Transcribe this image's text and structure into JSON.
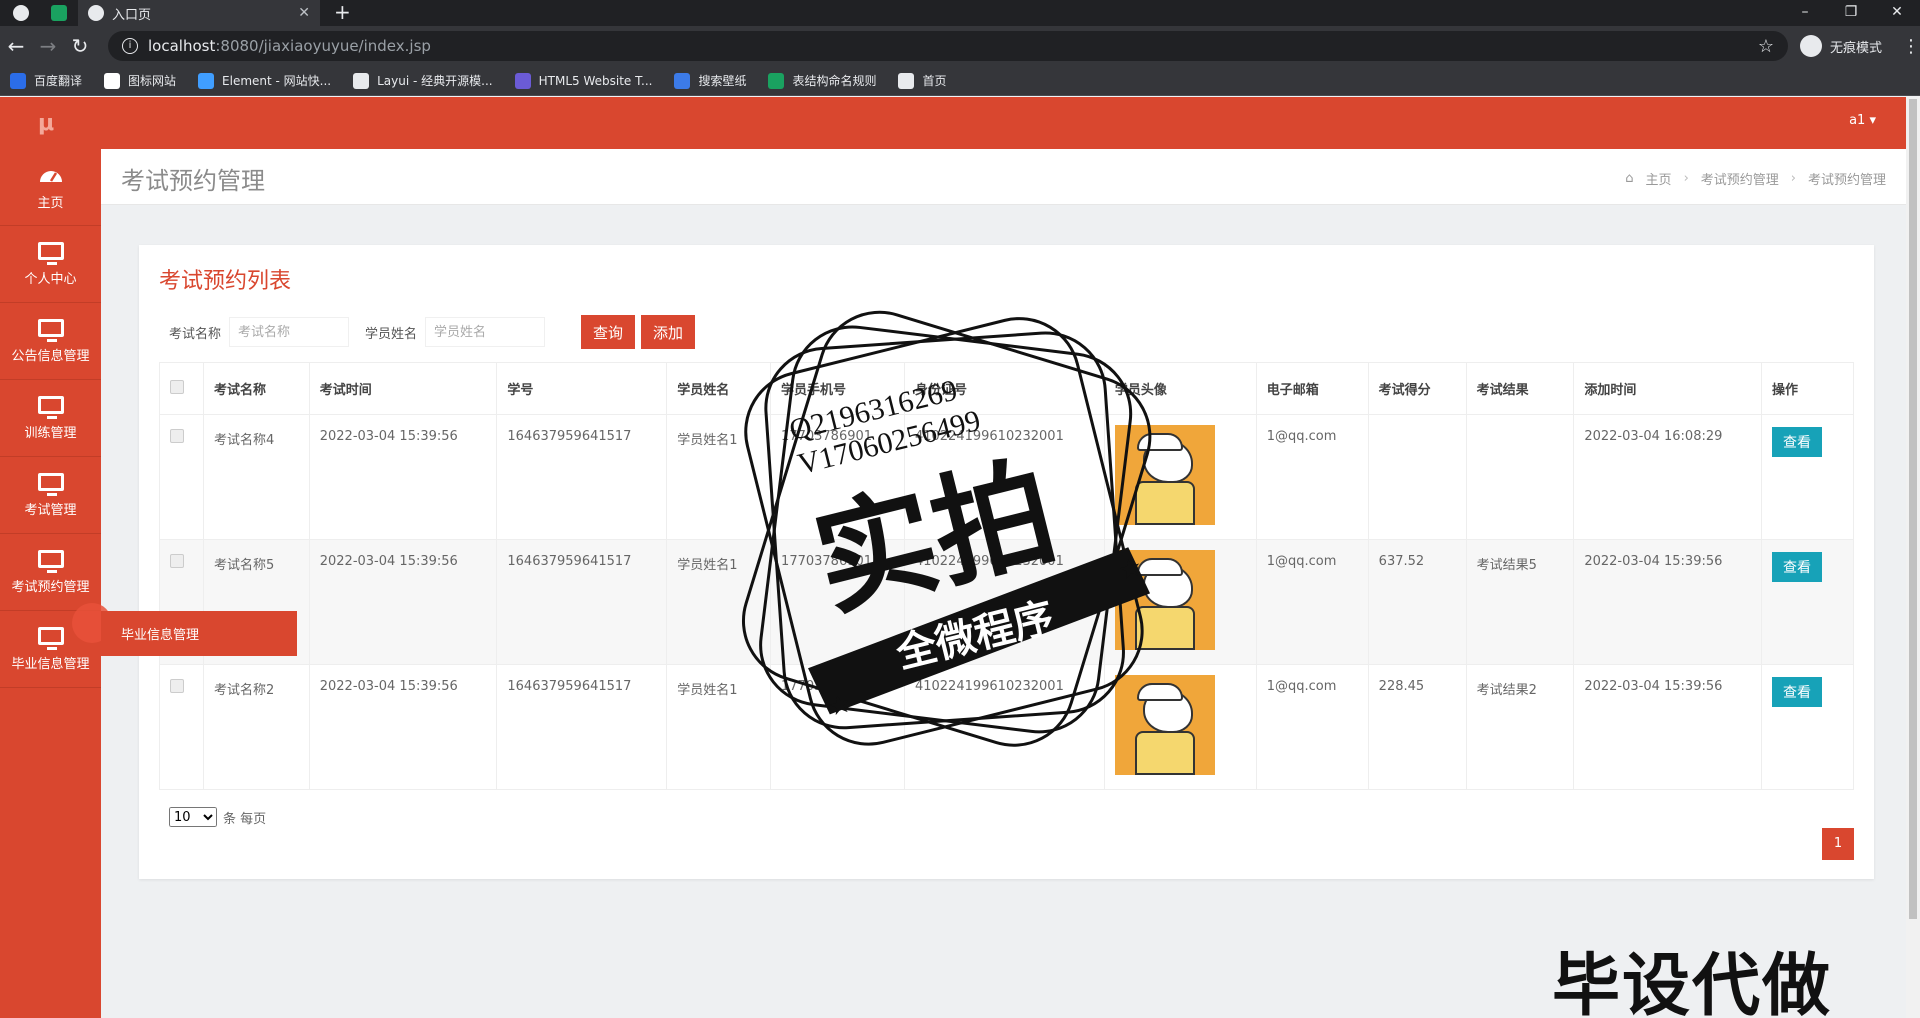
{
  "browser": {
    "tab_title": "入口页",
    "url_host": "localhost",
    "url_path": ":8080/jiaxiaoyuyue/index.jsp",
    "profile_label": "无痕模式",
    "bookmarks": [
      {
        "label": "百度翻译",
        "color": "#2b6de8"
      },
      {
        "label": "图标网站",
        "color": "#ffffff"
      },
      {
        "label": "Element - 网站快...",
        "color": "#409eff"
      },
      {
        "label": "Layui - 经典开源模...",
        "color": "#e8eaed"
      },
      {
        "label": "HTML5 Website T...",
        "color": "#6b5bd6"
      },
      {
        "label": "搜索壁纸",
        "color": "#3c7be8"
      },
      {
        "label": "表结构命名规则",
        "color": "#1aa260"
      },
      {
        "label": "首页",
        "color": "#e8eaed"
      }
    ]
  },
  "app": {
    "logo": "μ",
    "user": "a1 ▾",
    "accent_color": "#d9472f",
    "sidebar": [
      {
        "label": "主页",
        "icon": "dashboard-icon"
      },
      {
        "label": "个人中心",
        "icon": "monitor-icon"
      },
      {
        "label": "公告信息管理",
        "icon": "monitor-icon"
      },
      {
        "label": "训练管理",
        "icon": "monitor-icon"
      },
      {
        "label": "考试管理",
        "icon": "monitor-icon"
      },
      {
        "label": "考试预约管理",
        "icon": "monitor-icon"
      },
      {
        "label": "毕业信息管理",
        "icon": "monitor-icon"
      }
    ],
    "flyout_label": "毕业信息管理",
    "page_title": "考试预约管理",
    "breadcrumb": [
      "主页",
      "考试预约管理",
      "考试预约管理"
    ],
    "card_title": "考试预约列表",
    "filters": {
      "exam_name_label": "考试名称",
      "exam_name_placeholder": "考试名称",
      "student_name_label": "学员姓名",
      "student_name_placeholder": "学员姓名",
      "search_button": "查询",
      "add_button": "添加"
    },
    "table": {
      "headers": [
        "考试名称",
        "考试时间",
        "学号",
        "学员姓名",
        "学员手机号",
        "身份证号",
        "学员头像",
        "电子邮箱",
        "考试得分",
        "考试结果",
        "添加时间",
        "操作"
      ],
      "rows": [
        {
          "exam_name": "考试名称4",
          "exam_time": "2022-03-04 15:39:56",
          "student_no": "164637959641517",
          "student_name": "学员姓名1",
          "phone": "17703786901",
          "id_card": "410224199610232001",
          "email": "1@qq.com",
          "score": "",
          "result": "",
          "added": "2022-03-04 16:08:29",
          "action": "查看"
        },
        {
          "exam_name": "考试名称5",
          "exam_time": "2022-03-04 15:39:56",
          "student_no": "164637959641517",
          "student_name": "学员姓名1",
          "phone": "17703786901",
          "id_card": "410224199610232001",
          "email": "1@qq.com",
          "score": "637.52",
          "result": "考试结果5",
          "added": "2022-03-04 15:39:56",
          "action": "查看"
        },
        {
          "exam_name": "考试名称2",
          "exam_time": "2022-03-04 15:39:56",
          "student_no": "164637959641517",
          "student_name": "学员姓名1",
          "phone": "17703786901",
          "id_card": "410224199610232001",
          "email": "1@qq.com",
          "score": "228.45",
          "result": "考试结果2",
          "added": "2022-03-04 15:39:56",
          "action": "查看"
        }
      ]
    },
    "pagination": {
      "page_size": "10",
      "page_size_suffix": "条 每页",
      "current_page": "1"
    }
  },
  "watermark": {
    "contact_line1": "Q2196316269",
    "contact_line2": "V17060256499",
    "big_text": "实拍",
    "ribbon_text": "全微程序",
    "corner_text": "毕设代做"
  }
}
